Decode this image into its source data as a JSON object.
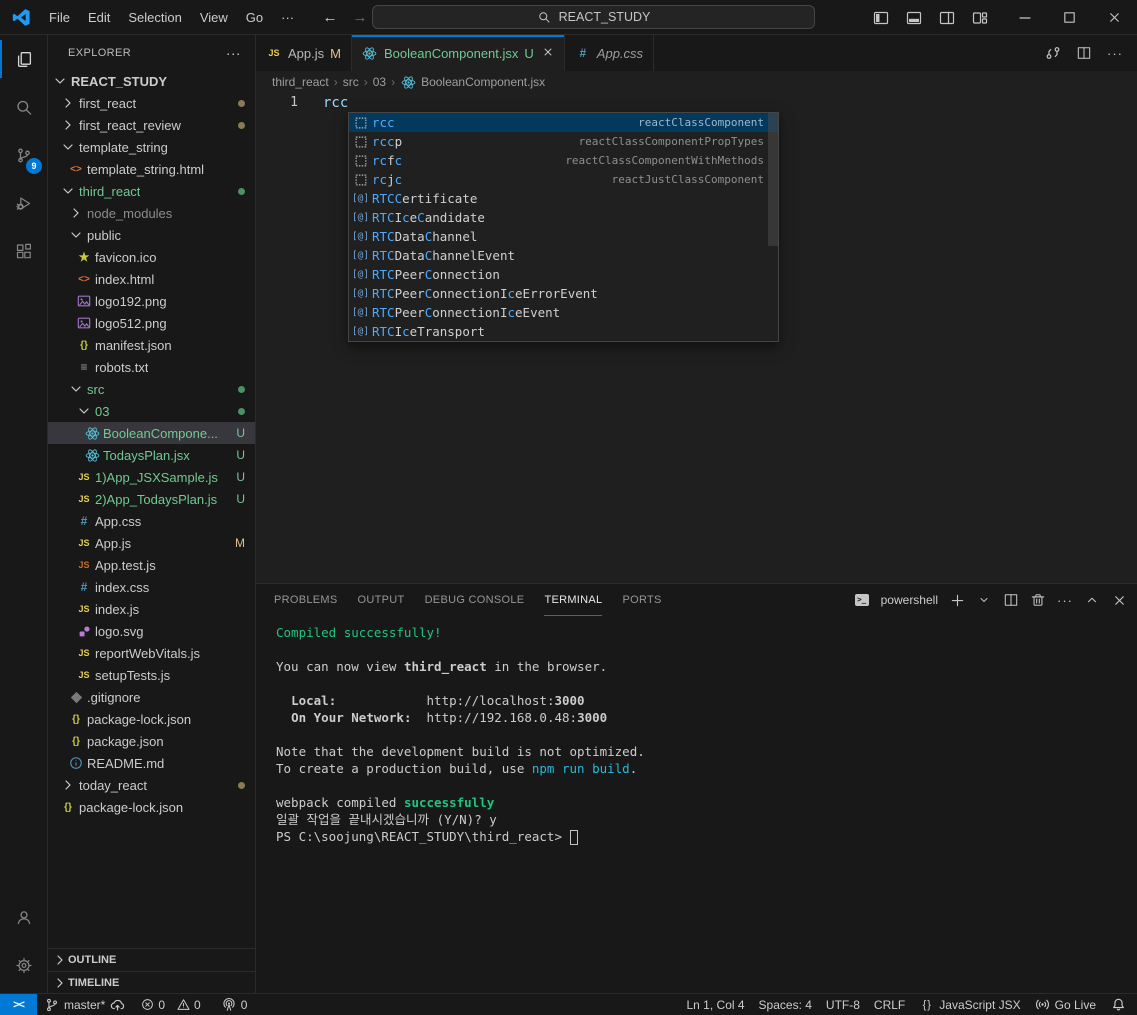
{
  "titlebar": {
    "menus": [
      {
        "name": "file",
        "label": "File"
      },
      {
        "name": "edit",
        "label": "Edit"
      },
      {
        "name": "selection",
        "label": "Selection"
      },
      {
        "name": "view",
        "label": "View"
      },
      {
        "name": "go",
        "label": "Go"
      },
      {
        "name": "more",
        "label": "···"
      }
    ],
    "search": {
      "value": "REACT_STUDY"
    },
    "layout_icons": [
      "layout-sidebar-icon",
      "layout-panel-icon",
      "layout-sidebar-right-icon",
      "layout-customize-icon"
    ],
    "window_controls": [
      "minimize-icon",
      "maximize-icon",
      "close-icon"
    ]
  },
  "activity_bar": {
    "top": [
      {
        "name": "explorer",
        "icon": "explorer-icon",
        "active": true
      },
      {
        "name": "search",
        "icon": "search-view-icon"
      },
      {
        "name": "source-control",
        "icon": "source-control-icon",
        "badge": "9"
      },
      {
        "name": "run-debug",
        "icon": "debug-icon"
      },
      {
        "name": "extensions",
        "icon": "extensions-icon"
      }
    ],
    "bottom": [
      {
        "name": "accounts",
        "icon": "account-icon"
      },
      {
        "name": "settings",
        "icon": "settings-gear-icon"
      }
    ]
  },
  "sidebar": {
    "header": {
      "title": "EXPLORER",
      "actions": "···"
    },
    "root": {
      "label": "REACT_STUDY"
    },
    "tree": [
      {
        "label": "first_react",
        "chevron": "right",
        "level": 1,
        "badge": "dot-mod"
      },
      {
        "label": "first_react_review",
        "chevron": "right",
        "level": 1,
        "badge": "dot-mod"
      },
      {
        "label": "template_string",
        "chevron": "down",
        "level": 1
      },
      {
        "label": "template_string.html",
        "icon": "html-icon",
        "level": 2
      },
      {
        "label": "third_react",
        "chevron": "down",
        "level": 1,
        "color": "green",
        "badge": "dot-green"
      },
      {
        "label": "node_modules",
        "chevron": "right",
        "level": 2,
        "color": "dim"
      },
      {
        "label": "public",
        "chevron": "down",
        "level": 2
      },
      {
        "label": "favicon.ico",
        "icon": "star-icon",
        "level": 3
      },
      {
        "label": "index.html",
        "icon": "html-icon",
        "level": 3
      },
      {
        "label": "logo192.png",
        "icon": "image-icon",
        "level": 3
      },
      {
        "label": "logo512.png",
        "icon": "image-icon",
        "level": 3
      },
      {
        "label": "manifest.json",
        "icon": "braces-icon",
        "level": 3
      },
      {
        "label": "robots.txt",
        "icon": "text-file-icon",
        "level": 3
      },
      {
        "label": "src",
        "chevron": "down",
        "level": 2,
        "color": "green",
        "badge": "dot-green"
      },
      {
        "label": "03",
        "chevron": "down",
        "level": 3,
        "color": "green",
        "badge": "dot-green"
      },
      {
        "label": "BooleanCompone...",
        "icon": "react-icon",
        "level": 4,
        "color": "green",
        "badge": "U",
        "selected": true
      },
      {
        "label": "TodaysPlan.jsx",
        "icon": "react-icon",
        "level": 4,
        "color": "green",
        "badge": "U"
      },
      {
        "label": "1)App_JSXSample.js",
        "icon": "js-icon",
        "level": 3,
        "color": "green",
        "badge": "U"
      },
      {
        "label": "2)App_TodaysPlan.js",
        "icon": "js-icon",
        "level": 3,
        "color": "green",
        "badge": "U"
      },
      {
        "label": "App.css",
        "icon": "css-icon",
        "level": 3
      },
      {
        "label": "App.js",
        "icon": "js-icon",
        "level": 3,
        "badge": "M"
      },
      {
        "label": "App.test.js",
        "icon": "js-test-icon",
        "level": 3
      },
      {
        "label": "index.css",
        "icon": "css-icon",
        "level": 3
      },
      {
        "label": "index.js",
        "icon": "js-icon",
        "level": 3
      },
      {
        "label": "logo.svg",
        "icon": "svg-icon",
        "level": 3
      },
      {
        "label": "reportWebVitals.js",
        "icon": "js-icon",
        "level": 3
      },
      {
        "label": "setupTests.js",
        "icon": "js-icon",
        "level": 3
      },
      {
        "label": ".gitignore",
        "icon": "git-icon",
        "level": 2
      },
      {
        "label": "package-lock.json",
        "icon": "braces-icon",
        "level": 2
      },
      {
        "label": "package.json",
        "icon": "braces-icon",
        "level": 2
      },
      {
        "label": "README.md",
        "icon": "info-icon",
        "level": 2
      },
      {
        "label": "today_react",
        "chevron": "right",
        "level": 1,
        "badge": "dot-mod"
      },
      {
        "label": "package-lock.json",
        "icon": "braces-icon",
        "level": 1
      }
    ],
    "bottom_sections": [
      {
        "label": "OUTLINE"
      },
      {
        "label": "TIMELINE"
      }
    ]
  },
  "editor": {
    "tabs": [
      {
        "icon": "js-icon",
        "label": "App.js",
        "badge": "M",
        "kind": "inactive"
      },
      {
        "icon": "react-icon",
        "label": "BooleanComponent.jsx",
        "badge": "U",
        "close": true,
        "kind": "active"
      },
      {
        "icon": "css-icon",
        "label": "App.css",
        "kind": "preview"
      }
    ],
    "tab_actions": [
      "compare-icon",
      "split-icon",
      "ellipsis-icon"
    ],
    "breadcrumb": {
      "path": [
        "third_react",
        "src",
        "03"
      ],
      "file": {
        "icon": "react-icon",
        "label": "BooleanComponent.jsx"
      }
    },
    "lines": [
      {
        "number": "1",
        "code": "rcc"
      }
    ]
  },
  "suggest": {
    "items": [
      {
        "icon": "snippet-icon",
        "selected": true,
        "segments": [
          {
            "t": "rcc",
            "m": true
          }
        ],
        "detail": "reactClassComponent"
      },
      {
        "icon": "snippet-icon",
        "segments": [
          {
            "t": "rcc",
            "m": true
          },
          {
            "t": "p"
          }
        ],
        "detail": "reactClassComponentPropTypes"
      },
      {
        "icon": "snippet-icon",
        "segments": [
          {
            "t": "rc",
            "m": true
          },
          {
            "t": "f"
          },
          {
            "t": "c",
            "m": true
          }
        ],
        "detail": "reactClassComponentWithMethods"
      },
      {
        "icon": "snippet-icon",
        "segments": [
          {
            "t": "rc",
            "m": true
          },
          {
            "t": "j"
          },
          {
            "t": "c",
            "m": true
          }
        ],
        "detail": "reactJustClassComponent"
      },
      {
        "icon": "symbol-icon",
        "segments": [
          {
            "t": "RTCC",
            "m": true
          },
          {
            "t": "ertificate"
          }
        ]
      },
      {
        "icon": "symbol-icon",
        "segments": [
          {
            "t": "RTC",
            "m": true
          },
          {
            "t": "I"
          },
          {
            "t": "c",
            "m": true
          },
          {
            "t": "e"
          },
          {
            "t": "C",
            "m": true
          },
          {
            "t": "andidate"
          }
        ]
      },
      {
        "icon": "symbol-icon",
        "segments": [
          {
            "t": "RTC",
            "m": true
          },
          {
            "t": "Data"
          },
          {
            "t": "C",
            "m": true
          },
          {
            "t": "hannel"
          }
        ]
      },
      {
        "icon": "symbol-icon",
        "segments": [
          {
            "t": "RTC",
            "m": true
          },
          {
            "t": "Data"
          },
          {
            "t": "C",
            "m": true
          },
          {
            "t": "hannelEvent"
          }
        ]
      },
      {
        "icon": "symbol-icon",
        "segments": [
          {
            "t": "RTC",
            "m": true
          },
          {
            "t": "Peer"
          },
          {
            "t": "C",
            "m": true
          },
          {
            "t": "onnection"
          }
        ]
      },
      {
        "icon": "symbol-icon",
        "segments": [
          {
            "t": "RTC",
            "m": true
          },
          {
            "t": "Peer"
          },
          {
            "t": "C",
            "m": true
          },
          {
            "t": "onnection"
          },
          {
            "t": "I"
          },
          {
            "t": "c",
            "m": true
          },
          {
            "t": "e"
          },
          {
            "t": "ErrorEvent"
          }
        ]
      },
      {
        "icon": "symbol-icon",
        "segments": [
          {
            "t": "RTC",
            "m": true
          },
          {
            "t": "Peer"
          },
          {
            "t": "C",
            "m": true
          },
          {
            "t": "onnection"
          },
          {
            "t": "I"
          },
          {
            "t": "c",
            "m": true
          },
          {
            "t": "e"
          },
          {
            "t": "Event"
          }
        ]
      },
      {
        "icon": "symbol-icon",
        "segments": [
          {
            "t": "RTC",
            "m": true
          },
          {
            "t": "I"
          },
          {
            "t": "c",
            "m": true
          },
          {
            "t": "e"
          },
          {
            "t": "Transport"
          }
        ]
      }
    ]
  },
  "panel": {
    "tabs": [
      {
        "label": "PROBLEMS"
      },
      {
        "label": "OUTPUT"
      },
      {
        "label": "DEBUG CONSOLE"
      },
      {
        "label": "TERMINAL",
        "active": true
      },
      {
        "label": "PORTS"
      }
    ],
    "shell": {
      "icon": "powershell-icon",
      "label": "powershell"
    },
    "action_icons": [
      "plus-icon",
      "chevron-down-small-icon",
      "split-icon",
      "trash-icon",
      "ellipsis-icon",
      "chevron-up-icon",
      "close-icon"
    ],
    "terminal_lines": [
      [
        {
          "t": "Compiled successfully!",
          "c": "green"
        }
      ],
      [],
      [
        {
          "t": "You can now view "
        },
        {
          "t": "third_react",
          "b": true
        },
        {
          "t": " in the browser."
        }
      ],
      [],
      [
        {
          "t": "  "
        },
        {
          "t": "Local:",
          "b": true
        },
        {
          "t": "            "
        },
        {
          "t": "http://localhost:"
        },
        {
          "t": "3000",
          "b": true
        }
      ],
      [
        {
          "t": "  "
        },
        {
          "t": "On Your Network:",
          "b": true
        },
        {
          "t": "  "
        },
        {
          "t": "http://192.168.0.48:"
        },
        {
          "t": "3000",
          "b": true
        }
      ],
      [],
      [
        {
          "t": "Note that the development build is not optimized."
        }
      ],
      [
        {
          "t": "To create a production build, use "
        },
        {
          "t": "npm run build",
          "c": "cyan"
        },
        {
          "t": "."
        }
      ],
      [],
      [
        {
          "t": "webpack compiled "
        },
        {
          "t": "successfully",
          "c": "green",
          "b": true
        }
      ],
      [
        {
          "t": "일괄 작업을 끝내시겠습니까 (Y/N)? y"
        }
      ],
      [
        {
          "t": "PS C:\\soojung\\REACT_STUDY\\third_react> "
        },
        {
          "cursor": true
        }
      ]
    ]
  },
  "statusbar": {
    "left": [
      {
        "name": "remote-indicator",
        "icon": "remote-icon",
        "remote": true
      },
      {
        "name": "git-branch",
        "icon": "branch-icon",
        "label": "master*",
        "icon_after": "cloud-icon"
      },
      {
        "name": "problems",
        "parts": [
          {
            "icon": "error-icon",
            "label": "0"
          },
          {
            "icon": "warning-icon",
            "label": "0"
          }
        ]
      },
      {
        "name": "ports-forwarded",
        "icon": "radio-tower-icon",
        "label": "0"
      }
    ],
    "right": [
      {
        "name": "cursor-position",
        "label": "Ln 1, Col 4"
      },
      {
        "name": "indentation",
        "label": "Spaces: 4"
      },
      {
        "name": "encoding",
        "label": "UTF-8"
      },
      {
        "name": "eol",
        "label": "CRLF"
      },
      {
        "name": "language-mode",
        "icon": "braces-plain-icon",
        "label": "JavaScript JSX"
      },
      {
        "name": "go-live",
        "icon": "go-live-icon",
        "label": "Go Live"
      },
      {
        "name": "notifications",
        "icon": "bell-icon"
      }
    ]
  },
  "colors": {
    "accent": "#0078d4",
    "untracked_green": "#73c991",
    "modified_tan": "#e2c08d",
    "match_blue": "#4daafc",
    "code_blue": "#9cdcfe"
  }
}
